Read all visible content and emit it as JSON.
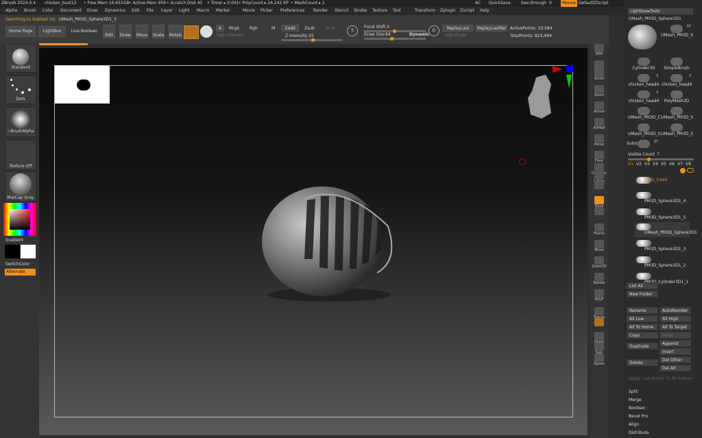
{
  "title": {
    "app": "ZBrush 2024.0.4",
    "file": "chicken_bust12",
    "freemem": "• Free Mem 16.651GB",
    "activemem": "• Active Mem 959",
    "scratch": "• Scratch Disk 45",
    "timer": "• Timer ▸ 0.001",
    "polycount": "• PolyCount ▸ 24.242 KP",
    "meshcount": "• MeshCount ▸ 2",
    "ac": "AC",
    "quicksave": "QuickSave",
    "seethrough": "See-through",
    "seethrough_val": "0",
    "menus": "Menus",
    "script": "DefaultZScript"
  },
  "menu": [
    "Alpha",
    "Brush",
    "Color",
    "Document",
    "Draw",
    "Dynamics",
    "Edit",
    "File",
    "Layer",
    "Light",
    "Macro",
    "Marker",
    "Movie",
    "Picker",
    "Preferences",
    "Render",
    "Stencil",
    "Stroke",
    "Texture",
    "Tool",
    "Transform",
    "Zplugin",
    "Zscript",
    "Help"
  ],
  "status": {
    "switching": "Switching to Subtool 34:",
    "subtool_name": "UMesh_PM3D_Sphere3D1_3"
  },
  "toolbar": {
    "homepage": "Home Page",
    "lightbox": "LightBox",
    "liveboolean": "Live Boolean",
    "edit": "Edit",
    "draw": "Draw",
    "move": "Move",
    "scale": "Scale",
    "rotate": "Rotate",
    "a": "A",
    "mrgb": "Mrgb",
    "rgb": "Rgb",
    "m": "M",
    "rgbint": "Rgb Intensity",
    "zadd": "Zadd",
    "zsub": "Zsub",
    "zcut": "Zcut",
    "zint": "Z Intensity",
    "zint_val": "25",
    "focal": "Focal Shift",
    "focal_val": "0",
    "drawsize": "Draw Size",
    "drawsize_val": "64",
    "dynamic": "Dynamic",
    "replaylast": "ReplayLast",
    "replaylastrel": "ReplayLastRel",
    "adjustlast": "AdjustLast",
    "activepoints": "ActivePoints: 10,584",
    "totalpoints": "TotalPoints: 824,494",
    "s": "S",
    "d": "D"
  },
  "leftshelf": {
    "standard": "Standard",
    "dots": "Dots",
    "brushalpha": "~BrushAlpha",
    "textureoff": "Texture Off",
    "matcap": "MatCap Gray",
    "gradient": "Gradient",
    "switchcolor": "SwitchColor",
    "alternate": "Alternate"
  },
  "rightshelf": [
    "BPR",
    "SPix 3",
    "Scroll",
    "Zoom",
    "Actual",
    "AAHalf",
    "Persp",
    "Floor",
    "Dynamic",
    "L.Sym",
    "",
    "Qxyz",
    "",
    "Frame",
    "Move",
    "Zoom3D",
    "Rotate",
    "PolyF",
    "Transp",
    "",
    "Ghost",
    "Solo",
    "Xpose"
  ],
  "rpanel": {
    "lightbox_tools": "Lightbox▸Tools",
    "current_tool": "UMesh_PM3D_Sphere3D1",
    "tools": [
      {
        "name": "UMesh_PM3D_S",
        "count": "37"
      },
      {
        "name": "Cylinder3D",
        "count": ""
      },
      {
        "name": "SimpleBrush",
        "count": ""
      },
      {
        "name": "chicken_head4",
        "count": "3"
      },
      {
        "name": "chicken_head4",
        "count": "3"
      },
      {
        "name": "chicken_head4",
        "count": "3"
      },
      {
        "name": "PolyMesh3D",
        "count": ""
      },
      {
        "name": "UMesh_PM3D_C",
        "count": ""
      },
      {
        "name": "UMesh_PM3D_S",
        "count": ""
      },
      {
        "name": "UMesh_PM3D_S",
        "count": ""
      },
      {
        "name": "UMesh_PM3D_S",
        "count": ""
      },
      {
        "name": "",
        "count": "37"
      }
    ],
    "subtool": "Subtool",
    "visible_count": "Visible Count",
    "visible_val": "7",
    "versions": [
      "V1",
      "V2",
      "V3",
      "V4",
      "V5",
      "V6",
      "V7",
      "V8"
    ],
    "subtools": [
      "body_trash",
      "PM3D_Sphere3D1_4",
      "PM3D_Sphere3D1_5",
      "UMesh_PM3D_Sphere3D1",
      "PM3D_Sphere3D1_3",
      "PM3D_Sphere3D1_2",
      "PM3D_Cylinder3D1_1"
    ],
    "listall": "List All",
    "newfolder": "New Folder",
    "rename": "Rename",
    "autoreorder": "AutoReorder",
    "alllow": "All Low",
    "allhigh": "All High",
    "alltohome": "All To Home",
    "alltotarget": "All To Target",
    "copy": "Copy",
    "paste": "Paste",
    "append": "Append",
    "duplicate": "Duplicate",
    "insert": "Insert",
    "delother": "Del Other",
    "delete": "Delete",
    "delall": "Del All",
    "applylast": "Apply Last Action To All Subtoo",
    "split": "Split",
    "merge": "Merge",
    "boolean": "Boolean",
    "bevelpro": "Bevel Pro",
    "align": "Align",
    "distribute": "Distribute"
  }
}
